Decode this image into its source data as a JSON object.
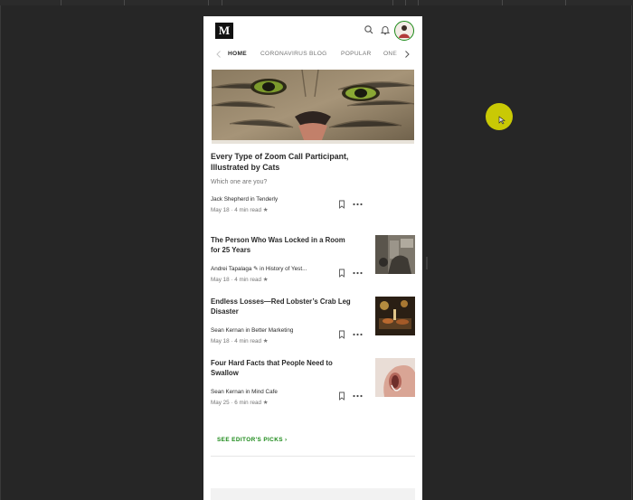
{
  "header": {
    "logo": "M"
  },
  "tabs": [
    {
      "label": "HOME",
      "active": true
    },
    {
      "label": "CORONAVIRUS BLOG",
      "active": false
    },
    {
      "label": "POPULAR",
      "active": false
    },
    {
      "label": "ONE",
      "active": false
    }
  ],
  "featured": {
    "title": "Every Type of Zoom Call Participant, Illustrated by Cats",
    "subtitle": "Which one are you?",
    "byline": "Jack Shepherd in Tenderly",
    "meta": "May 18 · 4 min read ★"
  },
  "stories": [
    {
      "title": "The Person Who Was Locked in a Room for 25 Years",
      "byline": "Andrei Tapalaga ✎ in History of Yest...",
      "meta": "May 18 · 4 min read ★"
    },
    {
      "title": "Endless Losses—Red Lobster’s Crab Leg Disaster",
      "byline": "Sean Kernan in Better Marketing",
      "meta": "May 18 · 4 min read ★"
    },
    {
      "title": "Four Hard Facts that People Need to Swallow",
      "byline": "Sean Kernan in Mind Cafe",
      "meta": "May 25 · 6 min read ★"
    }
  ],
  "see_editors_picks": "SEE EDITOR'S PICKS ›",
  "icons": [
    "medium-logo",
    "search-icon",
    "bell-icon",
    "avatar",
    "chevron-left-icon",
    "chevron-right-icon",
    "bookmark-icon",
    "more-icon",
    "cursor-icon"
  ],
  "colors": {
    "accent": "#1a8917",
    "text": "#292929",
    "muted": "#757575",
    "cursor": "#e6e600"
  }
}
